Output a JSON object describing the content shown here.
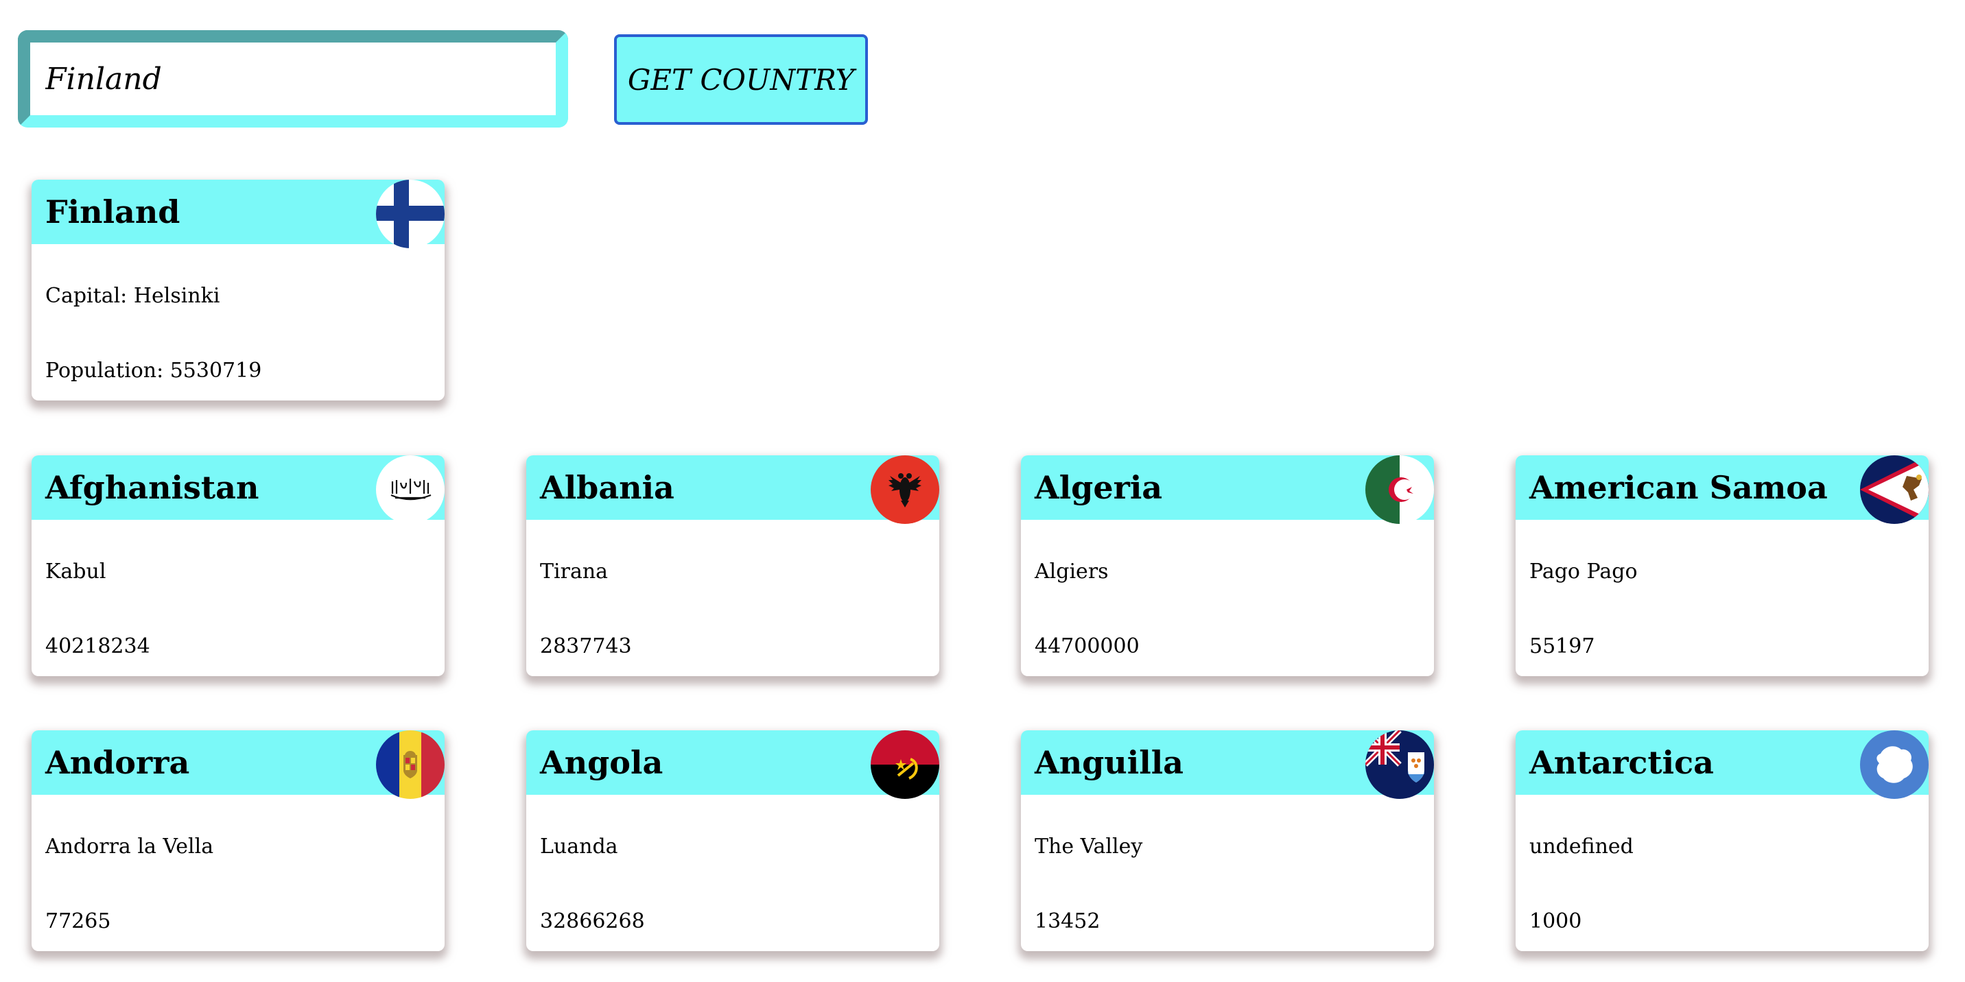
{
  "search": {
    "value": "Finland",
    "button_label": "GET COUNTRY"
  },
  "selected": {
    "name": "Finland",
    "capital": "Capital: Helsinki",
    "population": "Population: 5530719",
    "flag_icon": "finland-flag-icon"
  },
  "countries": [
    {
      "name": "Afghanistan",
      "capital": "Kabul",
      "population": "40218234",
      "flag_icon": "afghanistan-flag-icon"
    },
    {
      "name": "Albania",
      "capital": "Tirana",
      "population": "2837743",
      "flag_icon": "albania-flag-icon"
    },
    {
      "name": "Algeria",
      "capital": "Algiers",
      "population": "44700000",
      "flag_icon": "algeria-flag-icon"
    },
    {
      "name": "American Samoa",
      "capital": "Pago Pago",
      "population": "55197",
      "flag_icon": "american-samoa-flag-icon"
    },
    {
      "name": "Andorra",
      "capital": "Andorra la Vella",
      "population": "77265",
      "flag_icon": "andorra-flag-icon"
    },
    {
      "name": "Angola",
      "capital": "Luanda",
      "population": "32866268",
      "flag_icon": "angola-flag-icon"
    },
    {
      "name": "Anguilla",
      "capital": "The Valley",
      "population": "13452",
      "flag_icon": "anguilla-flag-icon"
    },
    {
      "name": "Antarctica",
      "capital": "undefined",
      "population": "1000",
      "flag_icon": "antarctica-flag-icon"
    }
  ],
  "colors": {
    "header": "#7bf9f8",
    "button_border": "#2a5fd1",
    "input_dark": "#53a5a7"
  }
}
